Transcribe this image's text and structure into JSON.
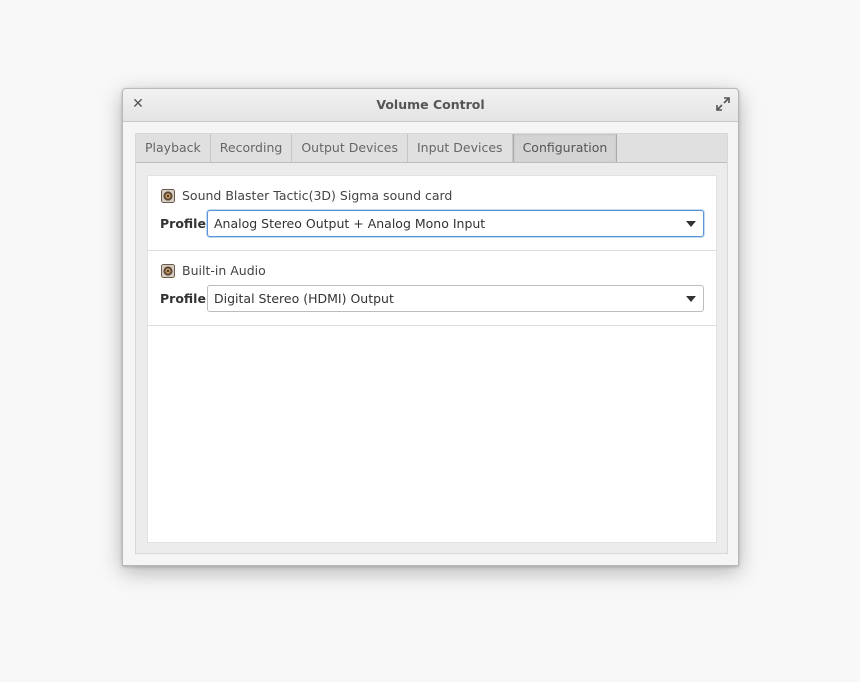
{
  "window": {
    "title": "Volume Control"
  },
  "tabs": [
    {
      "label": "Playback",
      "active": false
    },
    {
      "label": "Recording",
      "active": false
    },
    {
      "label": "Output Devices",
      "active": false
    },
    {
      "label": "Input Devices",
      "active": false
    },
    {
      "label": "Configuration",
      "active": true
    }
  ],
  "cards": [
    {
      "device_name": "Sound Blaster Tactic(3D) Sigma sound card",
      "profile_label": "Profile:",
      "profile_value": "Analog Stereo Output + Analog Mono Input",
      "icon": "audio-card-icon"
    },
    {
      "device_name": "Built-in Audio",
      "profile_label": "Profile:",
      "profile_value": "Digital Stereo (HDMI) Output",
      "icon": "audio-card-icon"
    }
  ],
  "colors": {
    "focus_border": "#5a94d6",
    "window_bg": "#f5f5f5"
  }
}
